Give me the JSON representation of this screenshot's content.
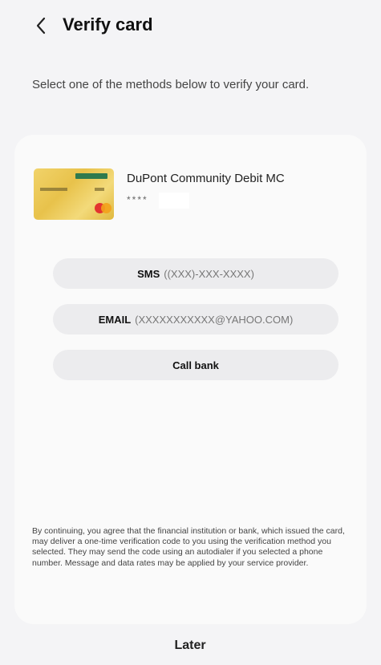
{
  "header": {
    "title": "Verify card"
  },
  "instruction": "Select one of the methods below to verify your card.",
  "card": {
    "name": "DuPont Community Debit MC",
    "number_masked": "****"
  },
  "methods": [
    {
      "label": "SMS",
      "value": "((XXX)-XXX-XXXX)"
    },
    {
      "label": "EMAIL",
      "value": "(XXXXXXXXXXX@YAHOO.COM)"
    },
    {
      "label": "Call bank",
      "value": ""
    }
  ],
  "disclaimer": "By continuing, you agree that the financial institution or bank, which issued the card, may deliver a one-time verification code to you using the verification method you selected. They may send the code using an autodialer if you selected a phone number. Message and data rates may be applied by your service provider.",
  "footer": {
    "later_label": "Later"
  },
  "colors": {
    "background": "#f4f4f6",
    "panel": "#fafafa",
    "button": "#ececee"
  }
}
